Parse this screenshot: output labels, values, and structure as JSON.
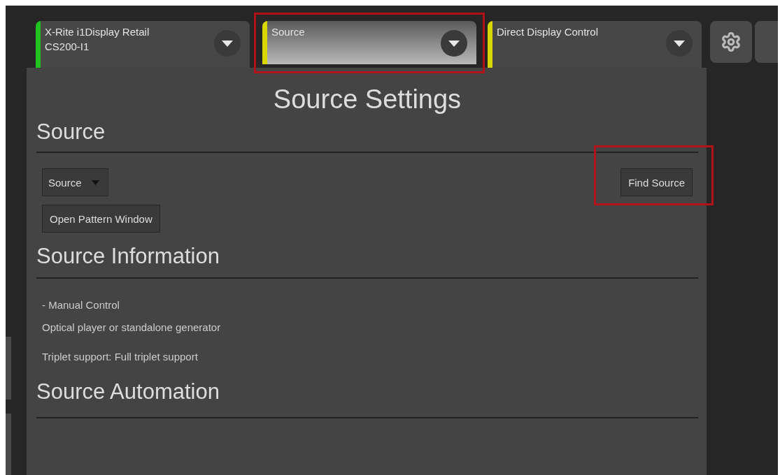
{
  "tabs": [
    {
      "label": "X-Rite i1Display Retail\nCS200-I1",
      "selected": false,
      "color": "#1fc21f",
      "highlighted": false
    },
    {
      "label": "Source",
      "selected": true,
      "color": "#d8d800",
      "highlighted": true
    },
    {
      "label": "Direct Display Control",
      "selected": false,
      "color": "#d8d800",
      "highlighted": false
    }
  ],
  "panel": {
    "title": "Source Settings",
    "sections": [
      {
        "heading": "Source",
        "kind": "controls",
        "select": {
          "value": "Source"
        },
        "buttons": [
          {
            "label": "Find Source",
            "highlighted": true
          },
          {
            "label": "Open Pattern Window"
          }
        ]
      },
      {
        "heading": "Source Information",
        "kind": "info",
        "lines": [
          "- Manual Control",
          "Optical player or standalone generator",
          "Triplet support: Full triplet support"
        ]
      },
      {
        "heading": "Source Automation",
        "kind": "empty"
      }
    ]
  }
}
